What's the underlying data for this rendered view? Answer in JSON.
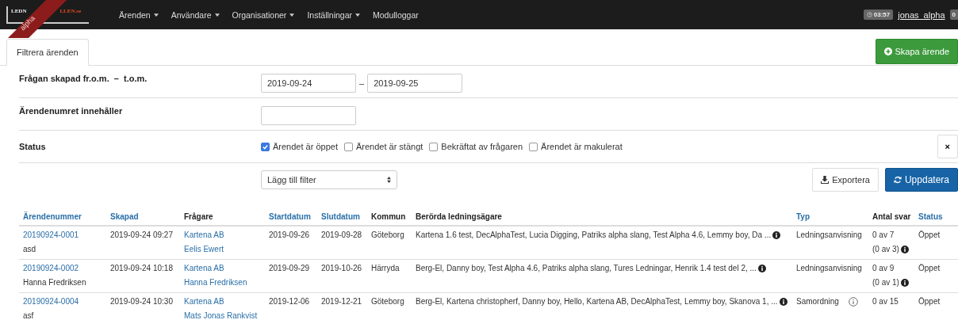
{
  "navbar": {
    "logo_parts": [
      "LEDN",
      "LLEN.se"
    ],
    "ribbon": "alpha",
    "menu": [
      {
        "label": "Ärenden",
        "dropdown": true
      },
      {
        "label": "Användare",
        "dropdown": true
      },
      {
        "label": "Organisationer",
        "dropdown": true
      },
      {
        "label": "Inställningar",
        "dropdown": true
      },
      {
        "label": "Modulloggar",
        "dropdown": false
      }
    ],
    "timer": "03:57",
    "user": "jonas_alpha",
    "badge": "0"
  },
  "tabs": [
    {
      "label": "Filtrera ärenden",
      "selected": true
    }
  ],
  "create_button": "Skapa ärende",
  "filters": {
    "date_range": {
      "label": "Frågan skapad fr.o.m.  –  t.o.m.",
      "from": "2019-09-24",
      "separator": "–",
      "to": "2019-09-25"
    },
    "case_number": {
      "label": "Ärendenumret innehåller"
    },
    "status": {
      "label": "Status",
      "options": [
        {
          "label": "Ärendet är öppet",
          "checked": true
        },
        {
          "label": "Ärendet är stängt",
          "checked": false
        },
        {
          "label": "Bekräftat av frågaren",
          "checked": false
        },
        {
          "label": "Ärendet är makulerat",
          "checked": false
        }
      ],
      "clear_button": "×"
    },
    "add_filter": "Lägg till filter",
    "export_button": "Exportera",
    "refresh_button": "Uppdatera"
  },
  "table": {
    "columns": [
      {
        "label": "Ärendenummer",
        "sortable": true
      },
      {
        "label": "Skapad",
        "sortable": true
      },
      {
        "label": "Frågare",
        "sortable": false
      },
      {
        "label": "Startdatum",
        "sortable": true
      },
      {
        "label": "Slutdatum",
        "sortable": true
      },
      {
        "label": "Kommun",
        "sortable": false
      },
      {
        "label": "Berörda ledningsägare",
        "sortable": false
      },
      {
        "label": "Typ",
        "sortable": true
      },
      {
        "label": "Antal svar",
        "sortable": false
      },
      {
        "label": "Status",
        "sortable": true
      }
    ],
    "rows": [
      {
        "case_number": "20190924-0001",
        "case_note": "asd",
        "created": "2019-09-24 09:27",
        "asker_org": "Kartena AB",
        "asker_person": "Eelis Ewert",
        "start": "2019-09-26",
        "end": "2019-09-28",
        "municipality": "Göteborg",
        "owners": "Kartena 1.6 test, DecAlphaTest, Lucia Digging, Patriks alpha slang, Test Alpha 4.6, Lemmy boy, Da ...",
        "type": "Ledningsanvisning",
        "type_icon": false,
        "answers": "0 av 7",
        "answers_sub": "(0 av 3)",
        "status": "Öppet"
      },
      {
        "case_number": "20190924-0002",
        "case_note": "Hanna Fredriksen",
        "created": "2019-09-24 10:18",
        "asker_org": "Kartena AB",
        "asker_person": "Hanna Fredriksen",
        "start": "2019-09-29",
        "end": "2019-10-26",
        "municipality": "Härryda",
        "owners": "Berg-El, Danny boy, Test Alpha 4.6, Patriks alpha slang, Tures Ledningar, Henrik 1.4 test del 2, ...",
        "type": "Ledningsanvisning",
        "type_icon": false,
        "answers": "0 av 9",
        "answers_sub": "(0 av 1)",
        "status": "Öppet"
      },
      {
        "case_number": "20190924-0004",
        "case_note": "asf",
        "created": "2019-09-24 10:30",
        "asker_org": "Kartena AB",
        "asker_person": "Mats Jonas Rankvist",
        "start": "2019-12-06",
        "end": "2019-12-21",
        "municipality": "Göteborg",
        "owners": "Berg-El, Kartena christopherf, Danny boy, Hello, Kartena AB, DecAlphaTest, Lemmy boy, Skanova 1, ...",
        "type": "Samordning",
        "type_icon": true,
        "answers": "0 av 15",
        "status": "Öppet"
      }
    ]
  }
}
